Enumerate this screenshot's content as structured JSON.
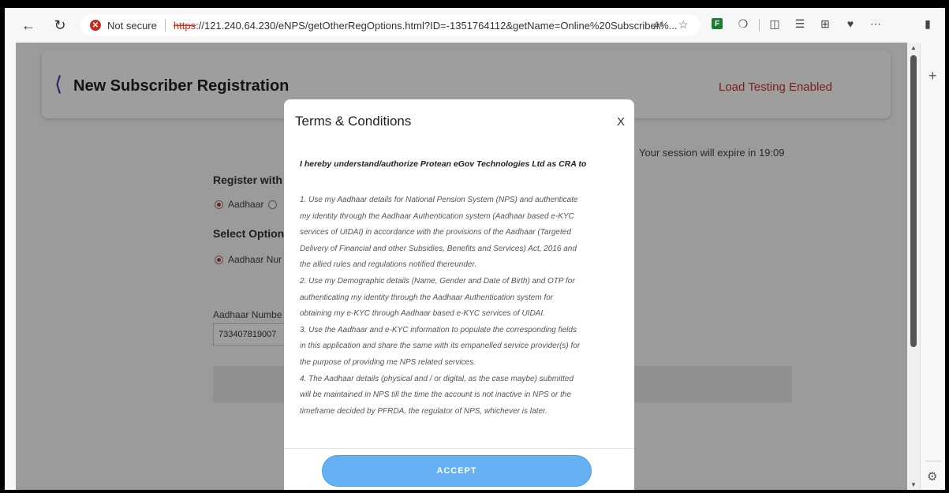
{
  "browser": {
    "security_label": "Not secure",
    "url_scheme": "https",
    "url_rest": "://121.240.64.230/eNPS/getOtherRegOptions.html?ID=-1351764112&getName=Online%20Subscriber%...",
    "icons": [
      "back-icon",
      "refresh-icon",
      "read-aloud-icon",
      "favorite-icon",
      "extension-icon",
      "puzzle-icon",
      "split-screen-icon",
      "favorites-list-icon",
      "collections-icon",
      "performance-icon",
      "more-icon",
      "sidebar-icon"
    ]
  },
  "header": {
    "title": "New Subscriber Registration",
    "status": "Load Testing Enabled"
  },
  "form": {
    "session_text": "Your session will expire in 19:09",
    "register_with_label": "Register with",
    "register_option": "Aadhaar",
    "select_option_label": "Select Option",
    "select_option_value": "Aadhaar Nur",
    "aadhaar_label": "Aadhaar Numbe",
    "aadhaar_value": "733407819007"
  },
  "modal": {
    "title": "Terms & Conditions",
    "close_label": "X",
    "lead": "I hereby understand/authorize Protean eGov Technologies Ltd as CRA to",
    "lines": [
      "1. Use my Aadhaar details for National Pension System (NPS) and authenticate",
      "my identity through the Aadhaar Authentication system (Aadhaar based e-KYC",
      "services of UIDAI) in accordance with the provisions of the Aadhaar (Targeted",
      "Delivery of Financial and other Subsidies, Benefits and Services) Act, 2016 and",
      "the allied rules and regulations notified thereunder.",
      "2. Use my Demographic details (Name, Gender and Date of Birth) and OTP for",
      "authenticating my identity through the Aadhaar Authentication system for",
      "obtaining my e-KYC through Aadhaar based e-KYC services of UIDAI.",
      "3. Use the Aadhaar and e-KYC information to populate the corresponding fields",
      "in this application and share the same with its empanelled service provider(s) for",
      "the purpose of providing me NPS related services.",
      "4. The Aadhaar details (physical and / or digital, as the case maybe) submitted",
      "will be maintained in NPS till the time the account is not inactive in NPS or the",
      "timeframe decided by PFRDA, the regulator of NPS, whichever is later."
    ],
    "accept_label": "ACCEPT"
  },
  "colors": {
    "accent_button": "#66b1f3",
    "status_red": "#d03030",
    "title_chevron": "#3a3aa0"
  }
}
